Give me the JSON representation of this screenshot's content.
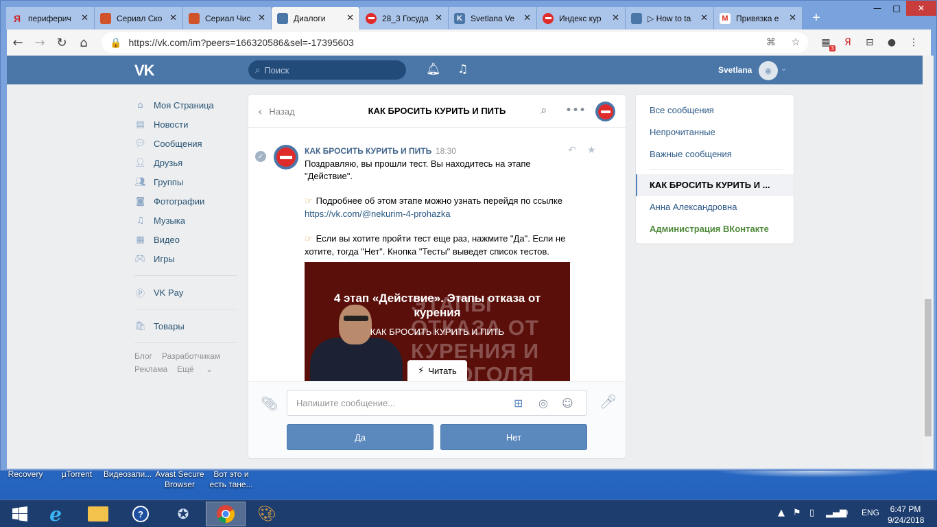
{
  "browser": {
    "tabs": [
      {
        "title": "периферич",
        "favicon_color": "#cc2222",
        "favicon_text": "Я"
      },
      {
        "title": "Сериал Ско",
        "favicon_color": "#d0532a",
        "favicon_text": "▲"
      },
      {
        "title": "Сериал Чис",
        "favicon_color": "#d0532a",
        "favicon_text": "▲"
      },
      {
        "title": "Диалоги",
        "favicon_color": "#4a76a8",
        "favicon_text": "▣",
        "active": true
      },
      {
        "title": "28_3 Госуда",
        "favicon_color": "#e02b2b",
        "favicon_text": "–"
      },
      {
        "title": "Svetlana Ve",
        "favicon_color": "#4a76a8",
        "favicon_text": "K"
      },
      {
        "title": "Индекс кур",
        "favicon_color": "#e02b2b",
        "favicon_text": "–"
      },
      {
        "title": "▷ How to ta",
        "favicon_color": "#4a76a8",
        "favicon_text": "▭"
      },
      {
        "title": "Привязка е",
        "favicon_color": "#d93025",
        "favicon_text": "M"
      }
    ],
    "url": "https://vk.com/im?peers=166320586&sel=-17395603",
    "ext_badge": "3"
  },
  "vk": {
    "logo": "VK",
    "search_placeholder": "Поиск",
    "user_name": "Svetlana",
    "nav": [
      {
        "label": "Моя Страница",
        "icon": "home-icon"
      },
      {
        "label": "Новости",
        "icon": "news-icon"
      },
      {
        "label": "Сообщения",
        "icon": "messages-icon"
      },
      {
        "label": "Друзья",
        "icon": "friends-icon"
      },
      {
        "label": "Группы",
        "icon": "groups-icon"
      },
      {
        "label": "Фотографии",
        "icon": "photo-icon"
      },
      {
        "label": "Музыка",
        "icon": "music-icon"
      },
      {
        "label": "Видео",
        "icon": "video-icon"
      },
      {
        "label": "Игры",
        "icon": "games-icon"
      }
    ],
    "nav_pay": "VK Pay",
    "nav_goods": "Товары",
    "footer": {
      "blog": "Блог",
      "devs": "Разработчикам",
      "ads": "Реклама",
      "more": "Ещё"
    }
  },
  "chat": {
    "back_label": "Назад",
    "title": "КАК БРОСИТЬ КУРИТЬ И ПИТЬ",
    "message": {
      "author": "КАК БРОСИТЬ КУРИТЬ И ПИТЬ",
      "time": "18:30",
      "p1": "Поздравляю, вы прошли тест. Вы находитесь на этапе \"Действие\".",
      "p2": "Подробнее об этом этапе можно узнать перейдя по ссылке",
      "p2_link": "https://vk.com/@nekurim-4-prohazka",
      "p3": "Если вы хотите пройти тест еще раз, нажмите \"Да\". Если не хотите, тогда \"Нет\". Кнопка \"Тесты\" выведет список тестов."
    },
    "article": {
      "title": "4 этап «Действие». Этапы отказа от курения",
      "subtitle": "КАК БРОСИТЬ КУРИТЬ И ПИТЬ",
      "bg_text": "ЭТАПЫ ОТКАЗА ОТ КУРЕНИЯ И АЛКОГОЛЯ",
      "read_label": "Читать"
    },
    "input_placeholder": "Напишите сообщение...",
    "buttons": {
      "yes": "Да",
      "no": "Нет"
    }
  },
  "filters": {
    "all": "Все сообщения",
    "unread": "Непрочитанные",
    "important": "Важные сообщения",
    "active_dialog": "КАК БРОСИТЬ КУРИТЬ И ...",
    "dialog2": "Анна Александровна",
    "dialog3": "Администрация ВКонтакте"
  },
  "desktop": {
    "icons": [
      "Recovery",
      "µTorrent",
      "Видеозапи...",
      "Avast Secure Browser",
      "Вот это и есть тане..."
    ]
  },
  "taskbar": {
    "lang": "ENG",
    "time": "6:47 PM",
    "date": "9/24/2018"
  }
}
